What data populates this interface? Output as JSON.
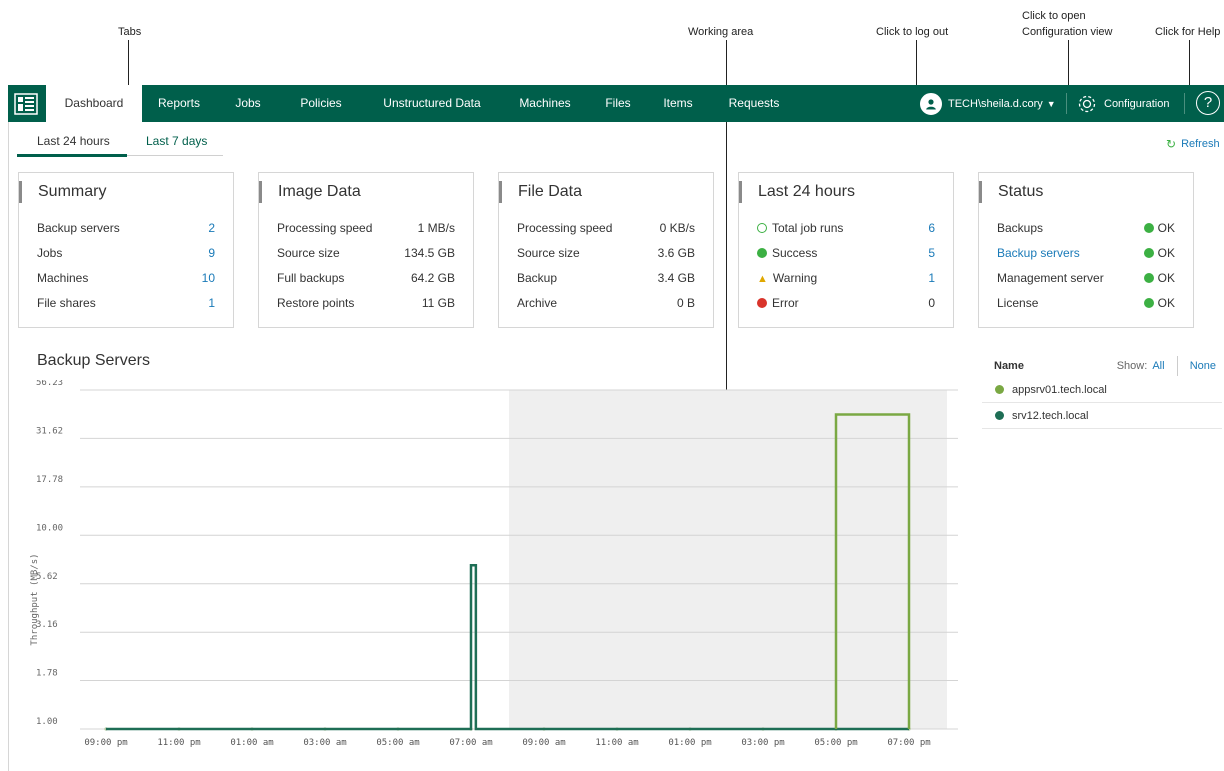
{
  "callouts": {
    "tabs": "Tabs",
    "working_area": "Working area",
    "logout": "Click to log out",
    "config_line1": "Click to open",
    "config_line2": "Configuration view",
    "help": "Click for Help"
  },
  "nav": {
    "tabs": [
      "Dashboard",
      "Reports",
      "Jobs",
      "Policies",
      "Unstructured Data",
      "Machines",
      "Files",
      "Items",
      "Requests"
    ],
    "user": "TECH\\sheila.d.cory",
    "configuration": "Configuration",
    "help": "?"
  },
  "subtabs": [
    "Last 24 hours",
    "Last 7 days"
  ],
  "refresh": "Refresh",
  "cards": {
    "summary": {
      "title": "Summary",
      "rows": [
        {
          "label": "Backup servers",
          "value": "2"
        },
        {
          "label": "Jobs",
          "value": "9"
        },
        {
          "label": "Machines",
          "value": "10"
        },
        {
          "label": "File shares",
          "value": "1"
        }
      ]
    },
    "image": {
      "title": "Image Data",
      "rows": [
        {
          "label": "Processing speed",
          "value": "1 MB/s"
        },
        {
          "label": "Source size",
          "value": "134.5 GB"
        },
        {
          "label": "Full backups",
          "value": "64.2 GB"
        },
        {
          "label": "Restore points",
          "value": "11 GB"
        }
      ]
    },
    "file": {
      "title": "File Data",
      "rows": [
        {
          "label": "Processing speed",
          "value": "0 KB/s"
        },
        {
          "label": "Source size",
          "value": "3.6 GB"
        },
        {
          "label": "Backup",
          "value": "3.4 GB"
        },
        {
          "label": "Archive",
          "value": "0 B"
        }
      ]
    },
    "last24": {
      "title": "Last 24 hours",
      "rows": [
        {
          "label": "Total job runs",
          "value": "6"
        },
        {
          "label": "Success",
          "value": "5"
        },
        {
          "label": "Warning",
          "value": "1"
        },
        {
          "label": "Error",
          "value": "0"
        }
      ]
    },
    "status": {
      "title": "Status",
      "rows": [
        {
          "label": "Backups",
          "value": "OK"
        },
        {
          "label": "Backup servers",
          "value": "OK"
        },
        {
          "label": "Management server",
          "value": "OK"
        },
        {
          "label": "License",
          "value": "OK"
        }
      ]
    }
  },
  "chart_section_title": "Backup Servers",
  "legend": {
    "name": "Name",
    "show": "Show:",
    "all": "All",
    "none": "None",
    "items": [
      {
        "name": "appsrv01.tech.local",
        "color": "#7aa843"
      },
      {
        "name": "srv12.tech.local",
        "color": "#1e6e55"
      }
    ]
  },
  "chart_data": {
    "type": "line",
    "ylabel": "Throughput (MB/s)",
    "yscale": "log",
    "y_ticks": [
      "1.00",
      "1.78",
      "3.16",
      "5.62",
      "10.00",
      "17.78",
      "31.62",
      "56.23"
    ],
    "x_ticks": [
      "09:00 pm",
      "11:00 pm",
      "01:00 am",
      "03:00 am",
      "05:00 am",
      "07:00 am",
      "09:00 am",
      "11:00 am",
      "01:00 pm",
      "03:00 pm",
      "05:00 pm",
      "07:00 pm"
    ],
    "ylim": [
      1.0,
      56.23
    ],
    "grid": true,
    "series": [
      {
        "name": "srv12.tech.local",
        "color": "#1e6e55",
        "points": [
          [
            "09:00 pm",
            1.0
          ],
          [
            "07:00 am",
            1.0
          ],
          [
            "07:00 am",
            7.0
          ],
          [
            "07:08 am",
            7.0
          ],
          [
            "07:08 am",
            1.0
          ],
          [
            "07:00 pm",
            1.0
          ]
        ]
      },
      {
        "name": "appsrv01.tech.local",
        "color": "#7aa843",
        "points": [
          [
            "05:00 pm",
            1.0
          ],
          [
            "05:00 pm",
            42.0
          ],
          [
            "07:00 pm",
            42.0
          ],
          [
            "07:00 pm",
            1.0
          ]
        ]
      }
    ]
  }
}
